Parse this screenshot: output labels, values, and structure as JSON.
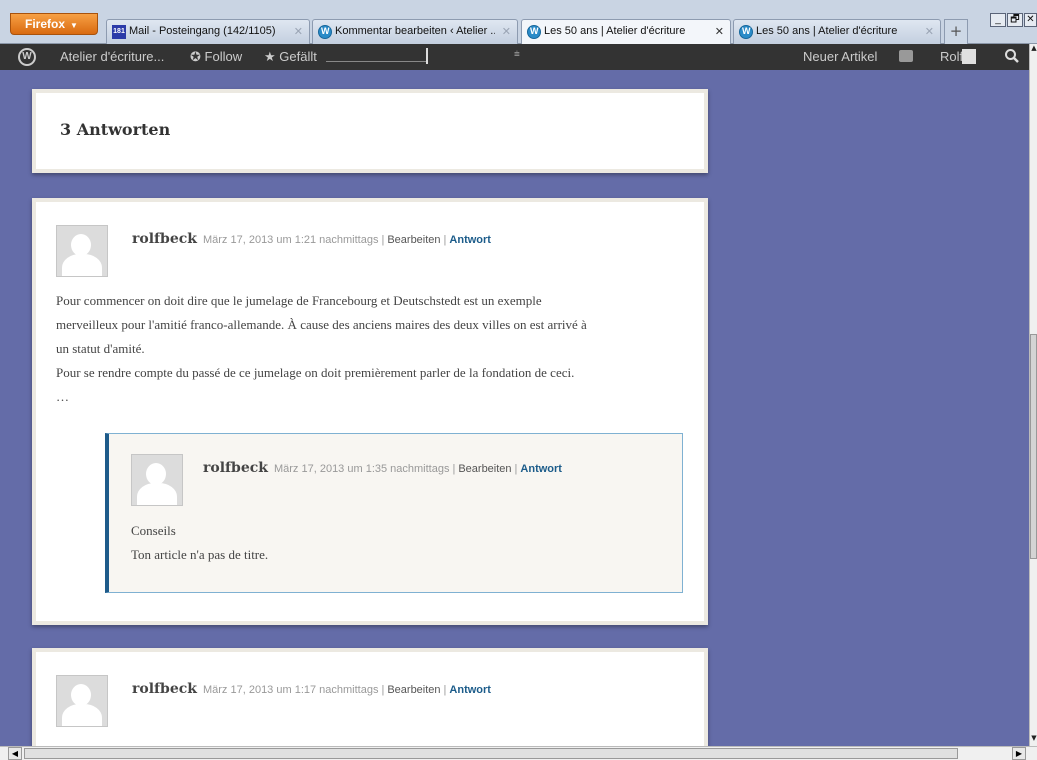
{
  "browser": {
    "app_button": "Firefox",
    "tabs": [
      {
        "title": "Mail - Posteingang (142/1105)",
        "icon": "mail-icon"
      },
      {
        "title": "Kommentar bearbeiten ‹ Atelier ...",
        "icon": "wordpress-icon"
      },
      {
        "title": "Les 50 ans | Atelier d'écriture",
        "icon": "wordpress-icon",
        "active": true
      },
      {
        "title": "Les 50 ans | Atelier d'écriture",
        "icon": "wordpress-icon"
      }
    ],
    "new_tab": "+",
    "window_controls": [
      "_",
      "🗗",
      "✕"
    ]
  },
  "admin_bar": {
    "site_name": "Atelier d'écriture...",
    "follow": "Follow",
    "like": "Gefällt",
    "new_post": "Neuer Artikel",
    "user": "Rolf"
  },
  "comments_section": {
    "title": "3 Antworten"
  },
  "comments": [
    {
      "author": "rolfbeck",
      "date": "März 17, 2013 um 1:21 nachmittags",
      "edit": "Bearbeiten",
      "reply": "Antwort",
      "paragraphs": [
        "Pour commencer on doit dire que le jumelage de Francebourg et Deutschstedt est un exemple",
        "merveilleux pour l'amitié franco-allemande. À cause des anciens maires des deux villes on est arrivé à",
        "un statut d'amité.",
        "Pour se rendre compte du passé de ce jumelage on doit premièrement parler de la fondation de ceci.",
        "…"
      ],
      "reply_comment": {
        "author": "rolfbeck",
        "date": "März 17, 2013 um 1:35 nachmittags",
        "edit": "Bearbeiten",
        "reply": "Antwort",
        "paragraphs": [
          "Conseils",
          "Ton article n'a pas de titre."
        ]
      }
    },
    {
      "author": "rolfbeck",
      "date": "März 17, 2013 um 1:17 nachmittags",
      "edit": "Bearbeiten",
      "reply": "Antwort"
    }
  ],
  "colors": {
    "page_background": "#646ca8",
    "admin_bar": "#333333",
    "reply_link": "#1c5c8a",
    "nested_border": "#1e5b8a"
  }
}
